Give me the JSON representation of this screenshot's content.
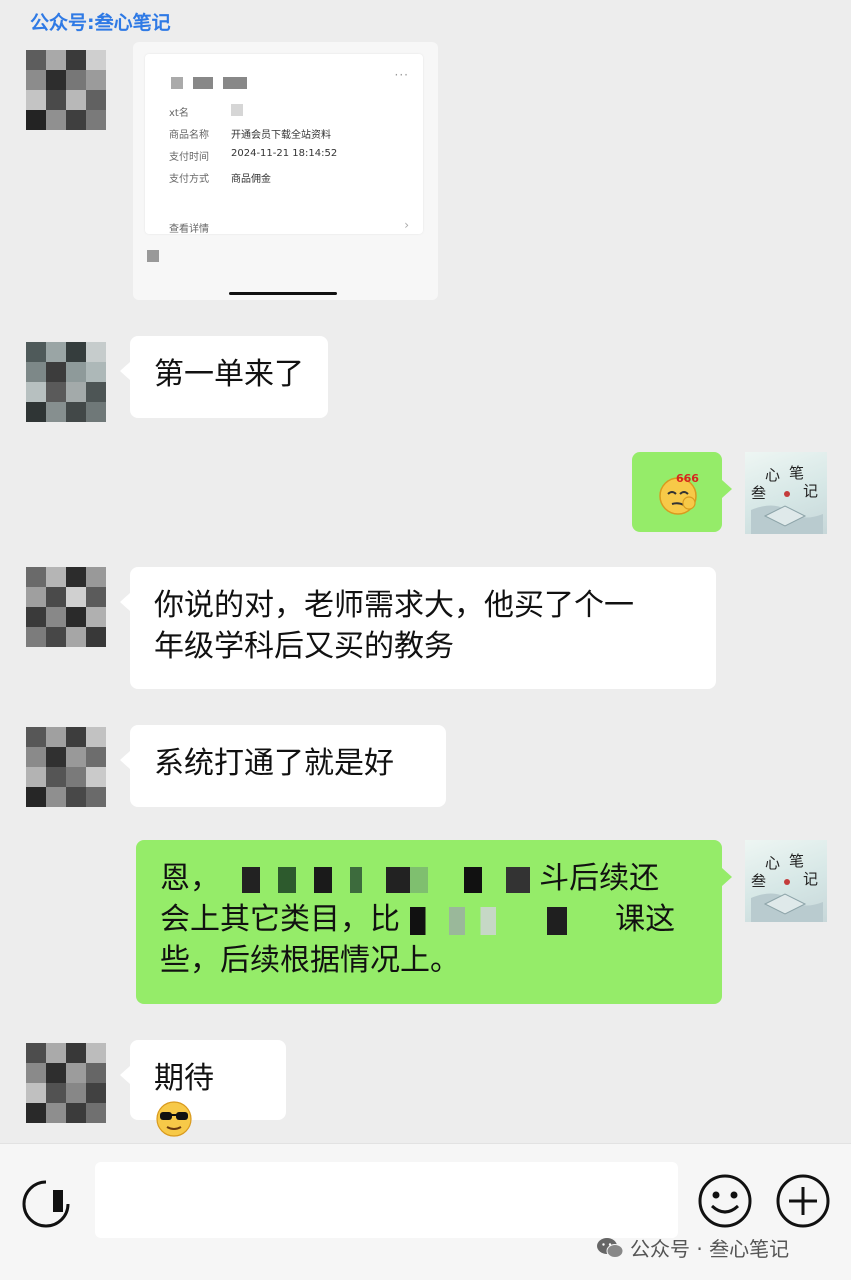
{
  "watermark_top": "公众号:叁心笔记",
  "payment_card": {
    "rows": [
      {
        "key": "xt名",
        "value": ""
      },
      {
        "key": "商品名称",
        "value": "开通会员下载全站资料"
      },
      {
        "key": "支付时间",
        "value": "2024-11-21 18:14:52"
      },
      {
        "key": "支付方式",
        "value": "商品佣金"
      }
    ],
    "detail_label": "查看详情",
    "more_icon": "more-dots-icon",
    "arrow_icon": "chevron-right-icon"
  },
  "messages": [
    {
      "side": "left",
      "text": "第一单来了"
    },
    {
      "side": "right",
      "text": "",
      "emoji": "666-emoji"
    },
    {
      "side": "left",
      "line1": "你说的对，老师需求大，他买了个一",
      "line2": "年级学科后又买的教务"
    },
    {
      "side": "left",
      "text": "系统打通了就是好"
    },
    {
      "side": "right",
      "line1_start": "恩，",
      "line1_end": "斗后续还",
      "line2_start": "会上其它类目，比",
      "line2_end": "课这",
      "line3": "些，后续根据情况上。"
    },
    {
      "side": "left",
      "text": "期待",
      "emoji": "sunglasses-emoji"
    }
  ],
  "bottom_bar": {
    "voice_icon": "voice-icon",
    "emoji_icon": "emoji-icon",
    "plus_icon": "plus-icon",
    "input_value": ""
  },
  "watermark_bottom": "公众号 · 叁心笔记",
  "colors": {
    "background": "#ededed",
    "bubble_left": "#ffffff",
    "bubble_right": "#95ec69",
    "watermark_top": "#2f7ae5"
  }
}
